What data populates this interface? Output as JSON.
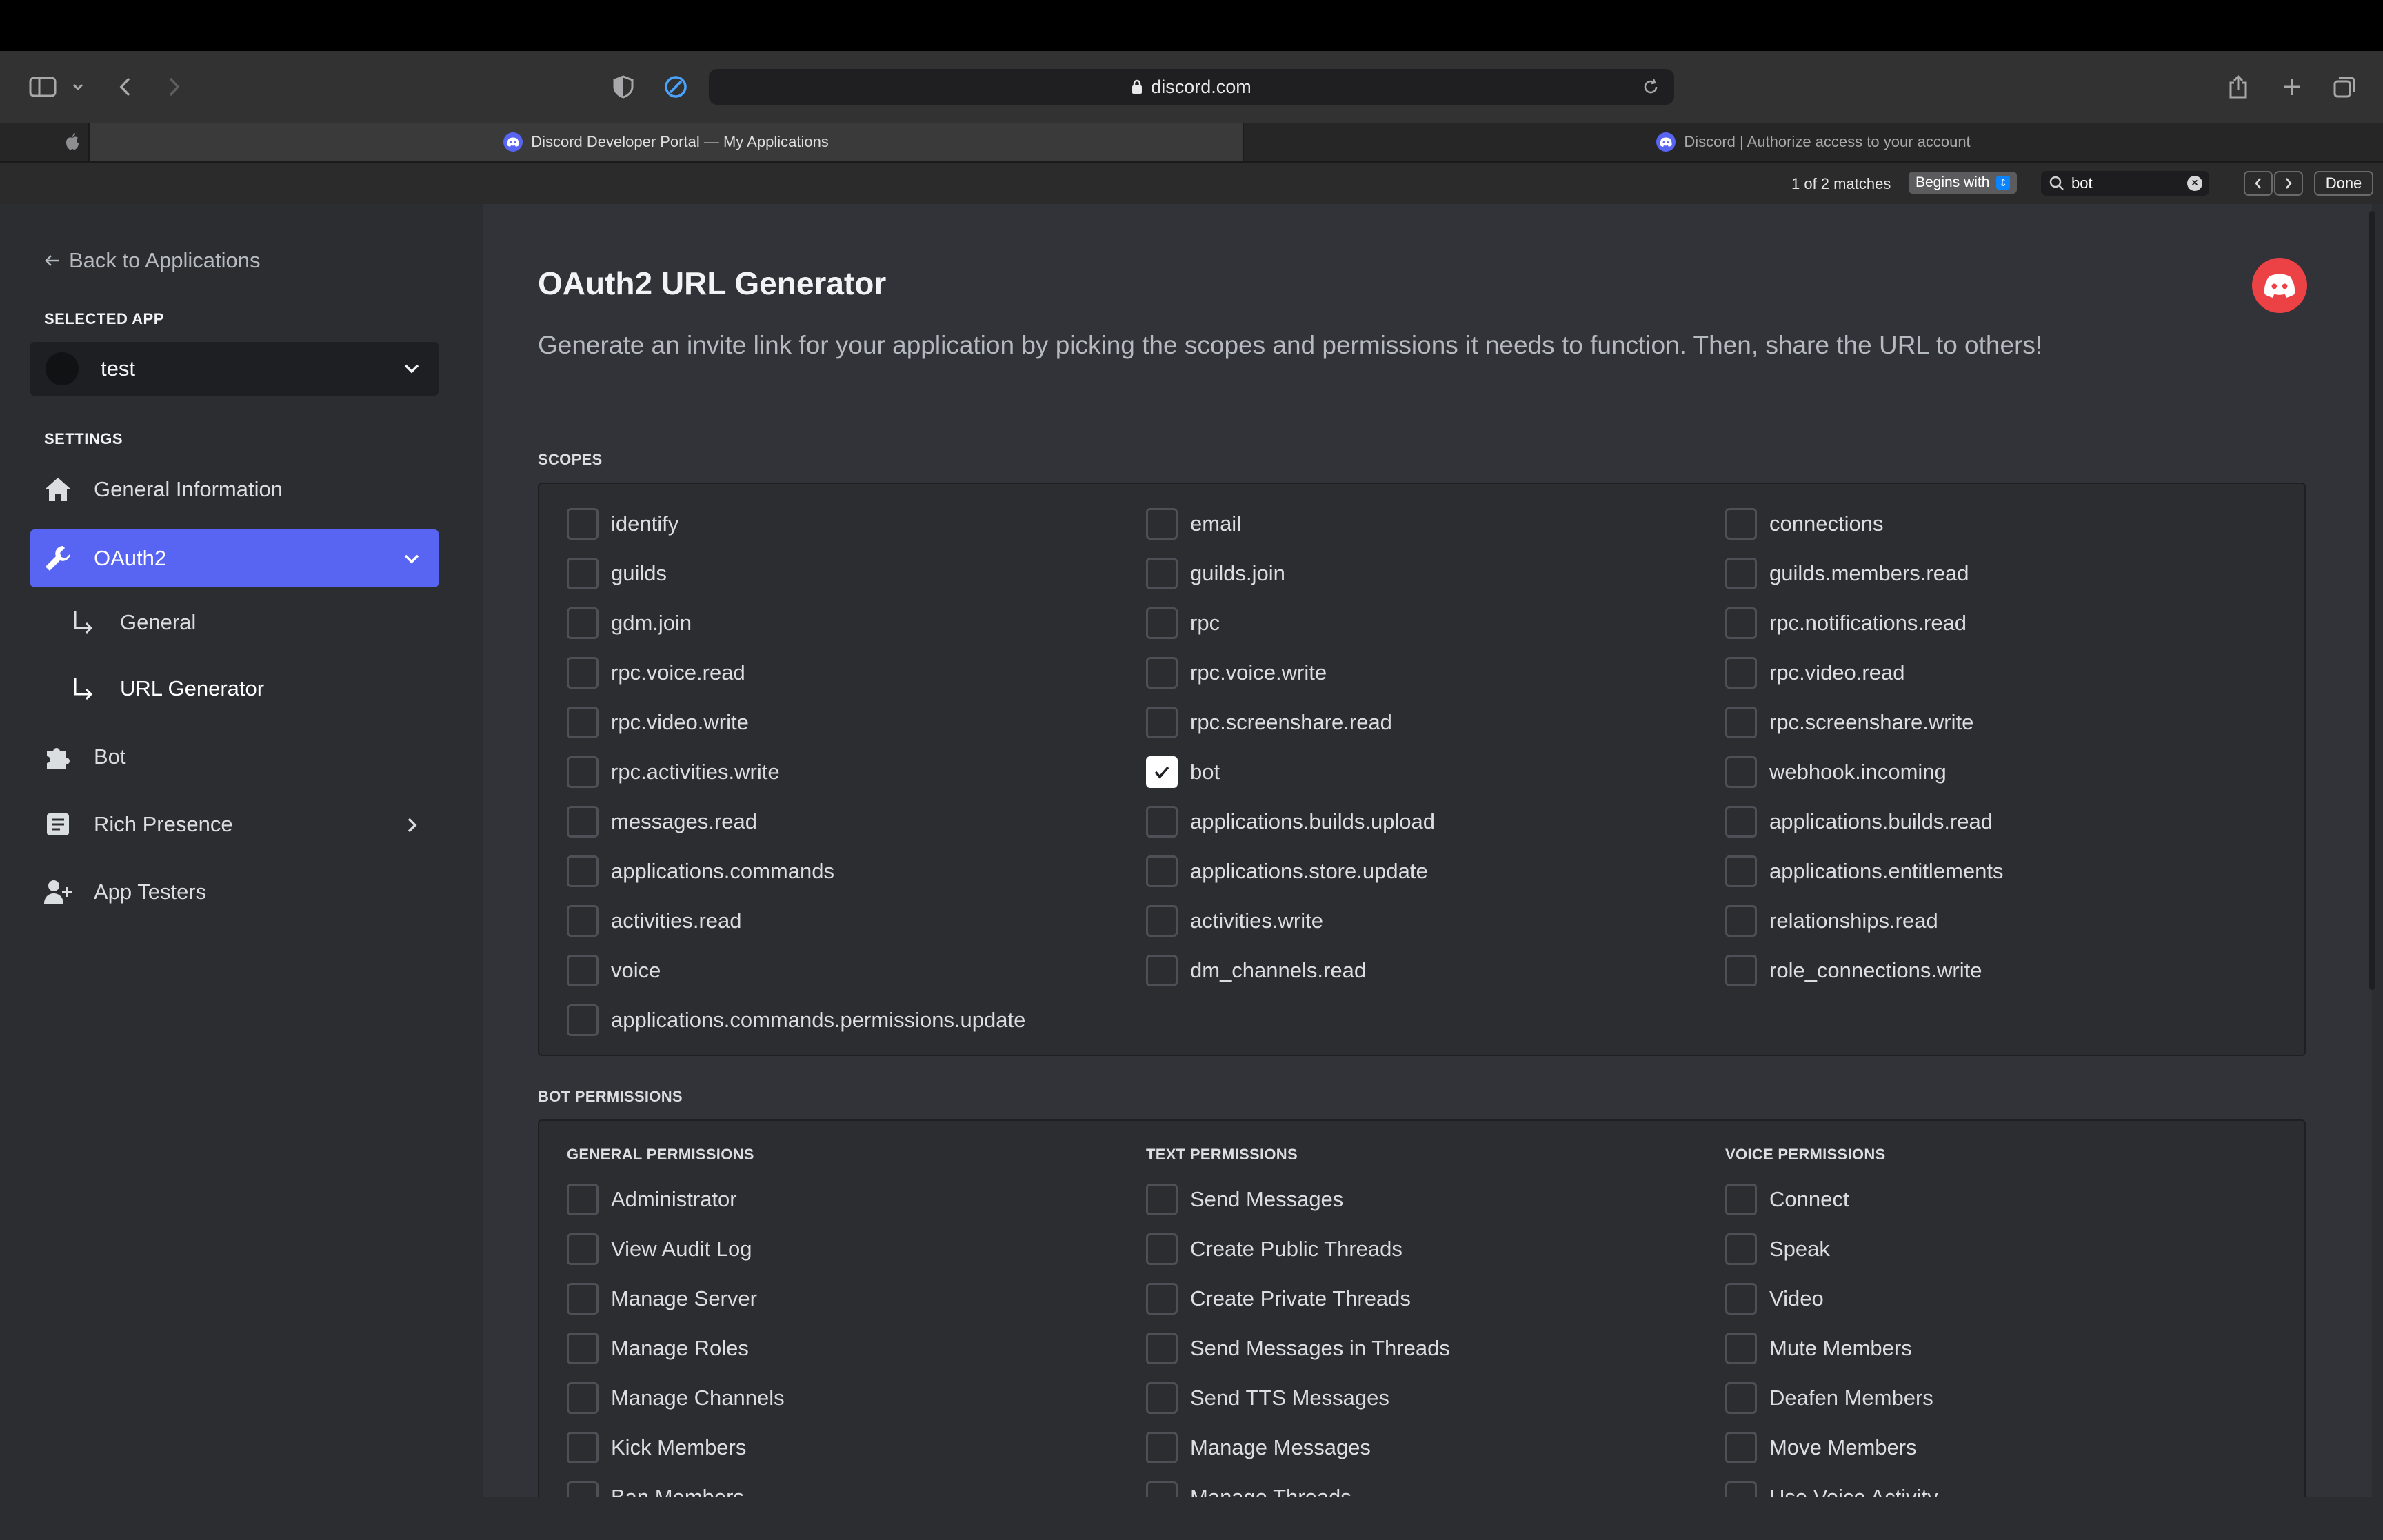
{
  "browser": {
    "url": "discord.com",
    "tabs": [
      {
        "title": "Discord Developer Portal — My Applications",
        "active": true
      },
      {
        "title": "Discord | Authorize access to your account",
        "active": false
      }
    ],
    "find": {
      "matches": "1 of 2 matches",
      "mode": "Begins with",
      "query": "bot",
      "done_label": "Done"
    }
  },
  "sidebar": {
    "back_label": "Back to Applications",
    "selected_app_heading": "SELECTED APP",
    "selected_app": "test",
    "settings_heading": "SETTINGS",
    "items": {
      "general_information": "General Information",
      "oauth2": "OAuth2",
      "oauth2_general": "General",
      "oauth2_url_generator": "URL Generator",
      "bot": "Bot",
      "rich_presence": "Rich Presence",
      "app_testers": "App Testers"
    }
  },
  "main": {
    "title": "OAuth2 URL Generator",
    "subtitle": "Generate an invite link for your application by picking the scopes and permissions it needs to function. Then, share the URL to others!",
    "scopes_label": "SCOPES",
    "scopes": [
      {
        "label": "identify",
        "checked": false
      },
      {
        "label": "email",
        "checked": false
      },
      {
        "label": "connections",
        "checked": false
      },
      {
        "label": "guilds",
        "checked": false
      },
      {
        "label": "guilds.join",
        "checked": false
      },
      {
        "label": "guilds.members.read",
        "checked": false
      },
      {
        "label": "gdm.join",
        "checked": false
      },
      {
        "label": "rpc",
        "checked": false
      },
      {
        "label": "rpc.notifications.read",
        "checked": false
      },
      {
        "label": "rpc.voice.read",
        "checked": false
      },
      {
        "label": "rpc.voice.write",
        "checked": false
      },
      {
        "label": "rpc.video.read",
        "checked": false
      },
      {
        "label": "rpc.video.write",
        "checked": false
      },
      {
        "label": "rpc.screenshare.read",
        "checked": false
      },
      {
        "label": "rpc.screenshare.write",
        "checked": false
      },
      {
        "label": "rpc.activities.write",
        "checked": false
      },
      {
        "label": "bot",
        "checked": true
      },
      {
        "label": "webhook.incoming",
        "checked": false
      },
      {
        "label": "messages.read",
        "checked": false
      },
      {
        "label": "applications.builds.upload",
        "checked": false
      },
      {
        "label": "applications.builds.read",
        "checked": false
      },
      {
        "label": "applications.commands",
        "checked": false
      },
      {
        "label": "applications.store.update",
        "checked": false
      },
      {
        "label": "applications.entitlements",
        "checked": false
      },
      {
        "label": "activities.read",
        "checked": false
      },
      {
        "label": "activities.write",
        "checked": false
      },
      {
        "label": "relationships.read",
        "checked": false
      },
      {
        "label": "voice",
        "checked": false
      },
      {
        "label": "dm_channels.read",
        "checked": false
      },
      {
        "label": "role_connections.write",
        "checked": false
      },
      {
        "label": "applications.commands.permissions.update",
        "checked": false
      }
    ],
    "bot_permissions_label": "BOT PERMISSIONS",
    "permission_columns": [
      {
        "heading": "GENERAL PERMISSIONS",
        "items": [
          "Administrator",
          "View Audit Log",
          "Manage Server",
          "Manage Roles",
          "Manage Channels",
          "Kick Members",
          "Ban Members"
        ]
      },
      {
        "heading": "TEXT PERMISSIONS",
        "items": [
          "Send Messages",
          "Create Public Threads",
          "Create Private Threads",
          "Send Messages in Threads",
          "Send TTS Messages",
          "Manage Messages",
          "Manage Threads"
        ]
      },
      {
        "heading": "VOICE PERMISSIONS",
        "items": [
          "Connect",
          "Speak",
          "Video",
          "Mute Members",
          "Deafen Members",
          "Move Members",
          "Use Voice Activity"
        ]
      }
    ]
  },
  "colors": {
    "accent": "#5865f2",
    "danger": "#ed4245",
    "background": "#313338",
    "sidebar": "#2b2d31"
  }
}
